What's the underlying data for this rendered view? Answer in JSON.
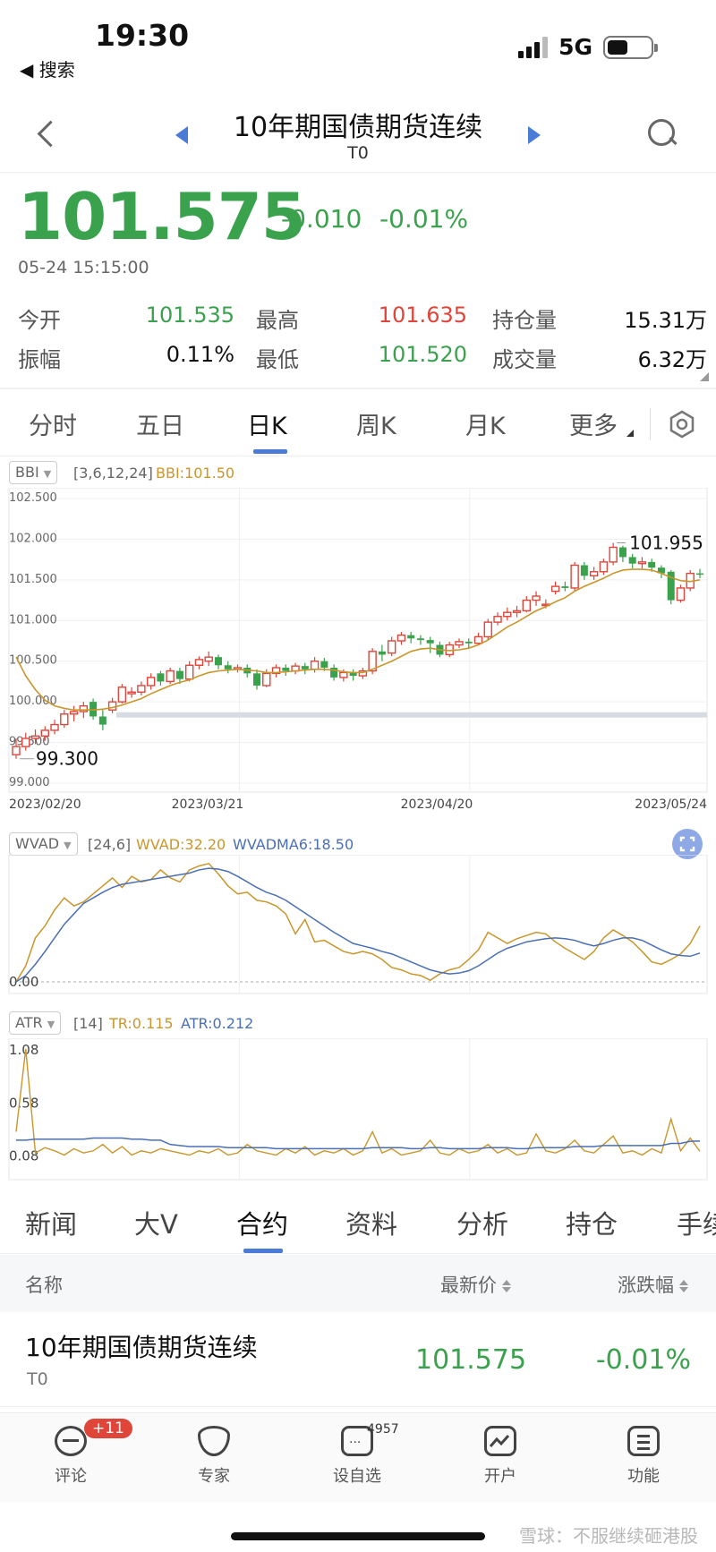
{
  "status": {
    "time": "19:30",
    "back_label": "◀ 搜索",
    "network": "5G"
  },
  "header": {
    "title": "10年期国债期货连续",
    "code": "T0"
  },
  "quote": {
    "price": "101.575",
    "change": "-0.010",
    "change_pct": "-0.01%",
    "timestamp": "05-24 15:15:00",
    "up_color": "#e0453a",
    "down_color": "#3aa14d"
  },
  "stats": [
    {
      "label": "今开",
      "value": "101.535",
      "color": "#3aa14d"
    },
    {
      "label": "最高",
      "value": "101.635",
      "color": "#e0453a"
    },
    {
      "label": "持仓量",
      "value": "15.31万",
      "color": "#111111"
    },
    {
      "label": "振幅",
      "value": "0.11%",
      "color": "#111111"
    },
    {
      "label": "最低",
      "value": "101.520",
      "color": "#3aa14d"
    },
    {
      "label": "成交量",
      "value": "6.32万",
      "color": "#111111"
    }
  ],
  "period_tabs": [
    "分时",
    "五日",
    "日K",
    "周K",
    "月K",
    "更多"
  ],
  "active_period": "日K",
  "bbi": {
    "chip": "BBI",
    "params": "[3,6,12,24]",
    "value_label": "BBI:101.50"
  },
  "wvad": {
    "chip": "WVAD",
    "params": "[24,6]",
    "value_label": "WVAD:32.20",
    "ma_label": "WVADMA6:18.50",
    "zero_label": "0.00"
  },
  "atr": {
    "chip": "ATR",
    "params": "[14]",
    "tr_label": "TR:0.115",
    "atr_label": "ATR:0.212",
    "y_ticks": [
      "1.08",
      "0.58",
      "0.08"
    ]
  },
  "chart_data": {
    "type": "candlestick",
    "y_ticks": [
      "102.500",
      "102.000",
      "101.500",
      "101.000",
      "100.500",
      "100.000",
      "99.500",
      "99.000"
    ],
    "ylim": [
      99.0,
      102.5
    ],
    "x_ticks": [
      "2023/02/20",
      "2023/03/21",
      "2023/04/20",
      "2023/05/24"
    ],
    "high_annotation": "101.955",
    "low_annotation": "99.300",
    "candles": [
      [
        99.35,
        99.45,
        99.3,
        99.55
      ],
      [
        99.45,
        99.55,
        99.4,
        99.62
      ],
      [
        99.55,
        99.58,
        99.48,
        99.66
      ],
      [
        99.58,
        99.65,
        99.52,
        99.7
      ],
      [
        99.65,
        99.72,
        99.6,
        99.78
      ],
      [
        99.72,
        99.85,
        99.68,
        99.9
      ],
      [
        99.85,
        99.88,
        99.76,
        99.95
      ],
      [
        99.88,
        99.95,
        99.8,
        100.0
      ],
      [
        100.0,
        99.82,
        99.78,
        100.04
      ],
      [
        99.82,
        99.72,
        99.65,
        99.9
      ],
      [
        99.9,
        100.0,
        99.86,
        100.05
      ],
      [
        100.0,
        100.18,
        99.98,
        100.22
      ],
      [
        100.1,
        100.12,
        100.05,
        100.18
      ],
      [
        100.12,
        100.2,
        100.08,
        100.25
      ],
      [
        100.2,
        100.3,
        100.15,
        100.35
      ],
      [
        100.35,
        100.25,
        100.2,
        100.38
      ],
      [
        100.25,
        100.38,
        100.22,
        100.42
      ],
      [
        100.38,
        100.28,
        100.22,
        100.42
      ],
      [
        100.28,
        100.45,
        100.25,
        100.5
      ],
      [
        100.45,
        100.52,
        100.4,
        100.56
      ],
      [
        100.5,
        100.55,
        100.44,
        100.62
      ],
      [
        100.55,
        100.45,
        100.4,
        100.58
      ],
      [
        100.45,
        100.4,
        100.35,
        100.5
      ],
      [
        100.4,
        100.42,
        100.36,
        100.46
      ],
      [
        100.42,
        100.35,
        100.3,
        100.46
      ],
      [
        100.35,
        100.2,
        100.15,
        100.4
      ],
      [
        100.2,
        100.35,
        100.18,
        100.4
      ],
      [
        100.35,
        100.42,
        100.3,
        100.46
      ],
      [
        100.42,
        100.38,
        100.32,
        100.46
      ],
      [
        100.38,
        100.44,
        100.34,
        100.48
      ],
      [
        100.44,
        100.4,
        100.34,
        100.48
      ],
      [
        100.4,
        100.5,
        100.36,
        100.55
      ],
      [
        100.5,
        100.42,
        100.38,
        100.54
      ],
      [
        100.42,
        100.3,
        100.26,
        100.46
      ],
      [
        100.3,
        100.36,
        100.25,
        100.4
      ],
      [
        100.36,
        100.32,
        100.26,
        100.4
      ],
      [
        100.32,
        100.38,
        100.28,
        100.42
      ],
      [
        100.38,
        100.62,
        100.34,
        100.66
      ],
      [
        100.62,
        100.58,
        100.5,
        100.7
      ],
      [
        100.6,
        100.75,
        100.56,
        100.8
      ],
      [
        100.75,
        100.82,
        100.7,
        100.86
      ],
      [
        100.82,
        100.78,
        100.72,
        100.86
      ],
      [
        100.78,
        100.76,
        100.7,
        100.82
      ],
      [
        100.76,
        100.72,
        100.6,
        100.8
      ],
      [
        100.7,
        100.58,
        100.55,
        100.74
      ],
      [
        100.58,
        100.7,
        100.55,
        100.74
      ],
      [
        100.7,
        100.74,
        100.66,
        100.78
      ],
      [
        100.74,
        100.72,
        100.66,
        100.78
      ],
      [
        100.72,
        100.8,
        100.7,
        100.85
      ],
      [
        100.8,
        100.98,
        100.76,
        101.02
      ],
      [
        100.98,
        101.05,
        100.94,
        101.1
      ],
      [
        101.05,
        101.1,
        101.0,
        101.16
      ],
      [
        101.1,
        101.12,
        101.04,
        101.18
      ],
      [
        101.12,
        101.25,
        101.1,
        101.3
      ],
      [
        101.25,
        101.3,
        101.18,
        101.36
      ],
      [
        101.2,
        101.2,
        101.15,
        101.26
      ],
      [
        101.36,
        101.42,
        101.32,
        101.48
      ],
      [
        101.42,
        101.4,
        101.36,
        101.48
      ],
      [
        101.4,
        101.68,
        101.36,
        101.72
      ],
      [
        101.68,
        101.55,
        101.5,
        101.72
      ],
      [
        101.55,
        101.6,
        101.5,
        101.66
      ],
      [
        101.6,
        101.72,
        101.56,
        101.76
      ],
      [
        101.72,
        101.9,
        101.68,
        101.955
      ],
      [
        101.9,
        101.78,
        101.72,
        101.92
      ],
      [
        101.78,
        101.7,
        101.64,
        101.82
      ],
      [
        101.7,
        101.72,
        101.64,
        101.78
      ],
      [
        101.72,
        101.65,
        101.6,
        101.76
      ],
      [
        101.65,
        101.58,
        101.52,
        101.68
      ],
      [
        101.6,
        101.25,
        101.2,
        101.62
      ],
      [
        101.25,
        101.4,
        101.22,
        101.44
      ],
      [
        101.4,
        101.58,
        101.36,
        101.62
      ],
      [
        101.58,
        101.575,
        101.52,
        101.635
      ]
    ],
    "bbi": [
      100.55,
      100.32,
      100.15,
      100.02,
      99.95,
      99.92,
      99.9,
      99.9,
      99.9,
      99.91,
      99.93,
      99.96,
      100.0,
      100.04,
      100.1,
      100.15,
      100.2,
      100.24,
      100.27,
      100.32,
      100.36,
      100.38,
      100.39,
      100.4,
      100.39,
      100.38,
      100.36,
      100.36,
      100.37,
      100.38,
      100.39,
      100.4,
      100.4,
      100.39,
      100.37,
      100.36,
      100.36,
      100.4,
      100.45,
      100.5,
      100.56,
      100.62,
      100.65,
      100.66,
      100.64,
      100.63,
      100.64,
      100.66,
      100.7,
      100.76,
      100.84,
      100.92,
      100.98,
      101.05,
      101.12,
      101.17,
      101.23,
      101.28,
      101.36,
      101.42,
      101.47,
      101.52,
      101.58,
      101.62,
      101.63,
      101.63,
      101.62,
      101.58,
      101.53,
      101.49,
      101.48,
      101.5
    ],
    "wvad": [
      0,
      20,
      55,
      70,
      90,
      105,
      95,
      100,
      110,
      120,
      130,
      118,
      132,
      125,
      128,
      140,
      130,
      125,
      140,
      145,
      148,
      135,
      120,
      110,
      112,
      102,
      100,
      95,
      85,
      60,
      78,
      50,
      52,
      45,
      38,
      35,
      38,
      35,
      28,
      18,
      15,
      10,
      8,
      2,
      10,
      15,
      18,
      28,
      40,
      62,
      55,
      48,
      54,
      58,
      62,
      60,
      50,
      42,
      35,
      28,
      38,
      55,
      65,
      58,
      50,
      38,
      25,
      22,
      28,
      35,
      48,
      70
    ],
    "wvadma": [
      0,
      8,
      22,
      38,
      55,
      72,
      85,
      98,
      105,
      112,
      118,
      122,
      124,
      126,
      128,
      130,
      132,
      134,
      136,
      140,
      142,
      141,
      138,
      132,
      125,
      118,
      112,
      108,
      102,
      94,
      86,
      78,
      70,
      62,
      55,
      48,
      45,
      42,
      38,
      35,
      30,
      25,
      20,
      15,
      12,
      10,
      11,
      14,
      20,
      28,
      36,
      42,
      46,
      50,
      52,
      54,
      55,
      54,
      52,
      48,
      45,
      48,
      52,
      55,
      55,
      52,
      46,
      40,
      35,
      33,
      32,
      36
    ],
    "tr": [
      0.3,
      1.08,
      0.1,
      0.15,
      0.12,
      0.08,
      0.14,
      0.1,
      0.12,
      0.18,
      0.1,
      0.16,
      0.08,
      0.12,
      0.1,
      0.14,
      0.12,
      0.1,
      0.08,
      0.12,
      0.1,
      0.14,
      0.08,
      0.1,
      0.18,
      0.12,
      0.1,
      0.08,
      0.14,
      0.1,
      0.16,
      0.08,
      0.12,
      0.1,
      0.14,
      0.08,
      0.12,
      0.3,
      0.1,
      0.14,
      0.08,
      0.1,
      0.12,
      0.22,
      0.1,
      0.08,
      0.14,
      0.1,
      0.12,
      0.18,
      0.1,
      0.14,
      0.08,
      0.1,
      0.28,
      0.12,
      0.1,
      0.14,
      0.22,
      0.12,
      0.1,
      0.18,
      0.26,
      0.1,
      0.12,
      0.08,
      0.14,
      0.1,
      0.42,
      0.12,
      0.24,
      0.115
    ],
    "atr": [
      0.22,
      0.22,
      0.23,
      0.23,
      0.23,
      0.23,
      0.23,
      0.23,
      0.24,
      0.24,
      0.24,
      0.24,
      0.23,
      0.23,
      0.22,
      0.22,
      0.18,
      0.17,
      0.16,
      0.16,
      0.16,
      0.16,
      0.15,
      0.15,
      0.15,
      0.15,
      0.15,
      0.14,
      0.14,
      0.14,
      0.14,
      0.14,
      0.14,
      0.14,
      0.14,
      0.14,
      0.14,
      0.15,
      0.15,
      0.15,
      0.15,
      0.14,
      0.14,
      0.15,
      0.15,
      0.14,
      0.14,
      0.14,
      0.14,
      0.15,
      0.15,
      0.15,
      0.14,
      0.14,
      0.15,
      0.15,
      0.15,
      0.15,
      0.16,
      0.16,
      0.16,
      0.17,
      0.17,
      0.17,
      0.17,
      0.17,
      0.17,
      0.17,
      0.19,
      0.19,
      0.21,
      0.212
    ]
  },
  "news_tabs": [
    "新闻",
    "大V",
    "合约",
    "资料",
    "分析",
    "持仓",
    "手续"
  ],
  "active_news_tab": "合约",
  "list": {
    "col_name": "名称",
    "col_price": "最新价",
    "col_pct": "涨跌幅",
    "rows": [
      {
        "name": "10年期国债期货连续",
        "code": "T0",
        "price": "101.575",
        "pct": "-0.01%"
      }
    ]
  },
  "bottom_nav": [
    {
      "icon": "comment-icon",
      "label": "评论"
    },
    {
      "icon": "expert-icon",
      "label": "专家"
    },
    {
      "icon": "watchlist-icon",
      "label": "设自选"
    },
    {
      "icon": "open-account-icon",
      "label": "开户"
    },
    {
      "icon": "menu-icon",
      "label": "功能"
    }
  ],
  "badges": {
    "comment": "+11",
    "watchlist": "4957"
  },
  "watermark": "雪球：不服继续砸港股"
}
